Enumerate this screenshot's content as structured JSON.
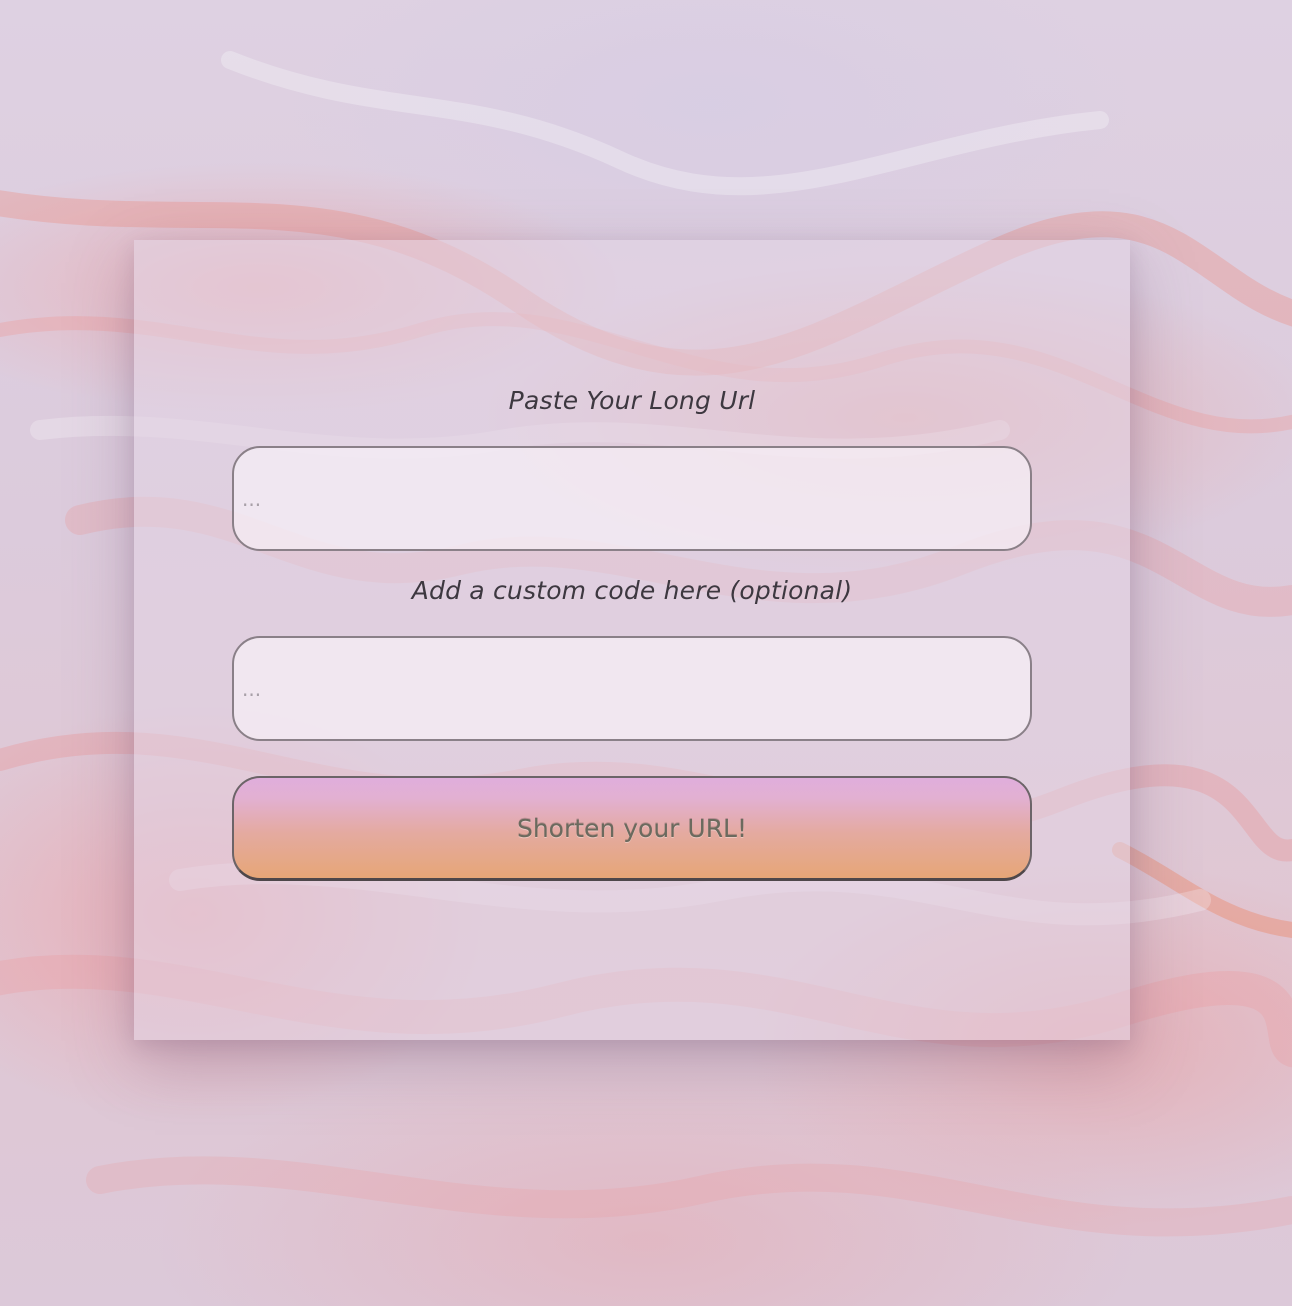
{
  "form": {
    "url_label": "Paste Your Long Url",
    "url_placeholder": "...",
    "url_value": "",
    "code_label": "Add a custom code here (optional)",
    "code_placeholder": "...",
    "code_value": "",
    "submit_label": "Shorten your URL!"
  },
  "colors": {
    "button_gradient_top": "#e0aedc",
    "button_gradient_bottom": "#e6a677",
    "label_text": "#3d3840",
    "field_border": "#8a8088"
  }
}
